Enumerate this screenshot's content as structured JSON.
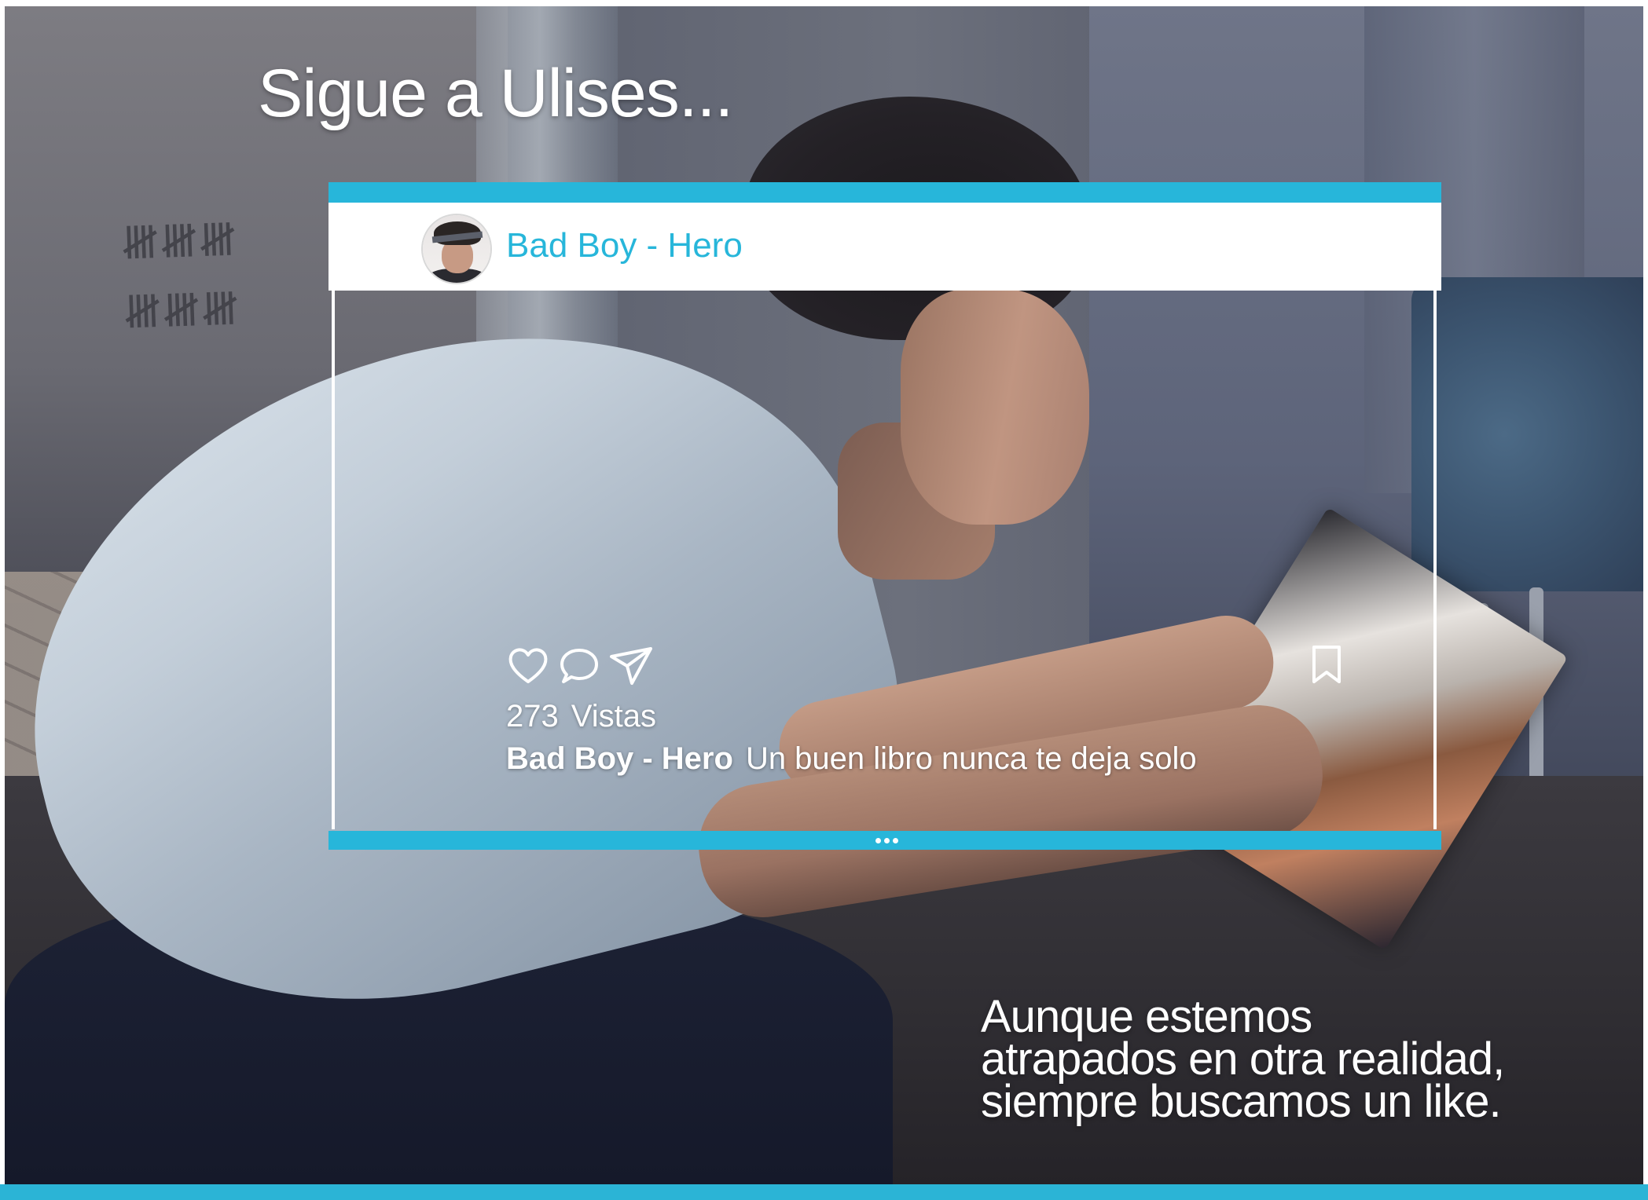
{
  "headline": "Sigue a Ulises...",
  "post": {
    "username": "Bad Boy - Hero",
    "views_count": "273",
    "views_label": "Vistas",
    "caption_user": "Bad Boy - Hero",
    "caption_text": "Un buen libro nunca te deja solo",
    "accent_color": "#27b6da",
    "icons": {
      "like": "heart-icon",
      "comment": "comment-bubble-icon",
      "share": "paper-plane-icon",
      "save": "bookmark-icon"
    }
  },
  "tagline": {
    "line1": "Aunque estemos",
    "line2": "atrapados en otra realidad,",
    "line3": "siempre buscamos un like."
  }
}
